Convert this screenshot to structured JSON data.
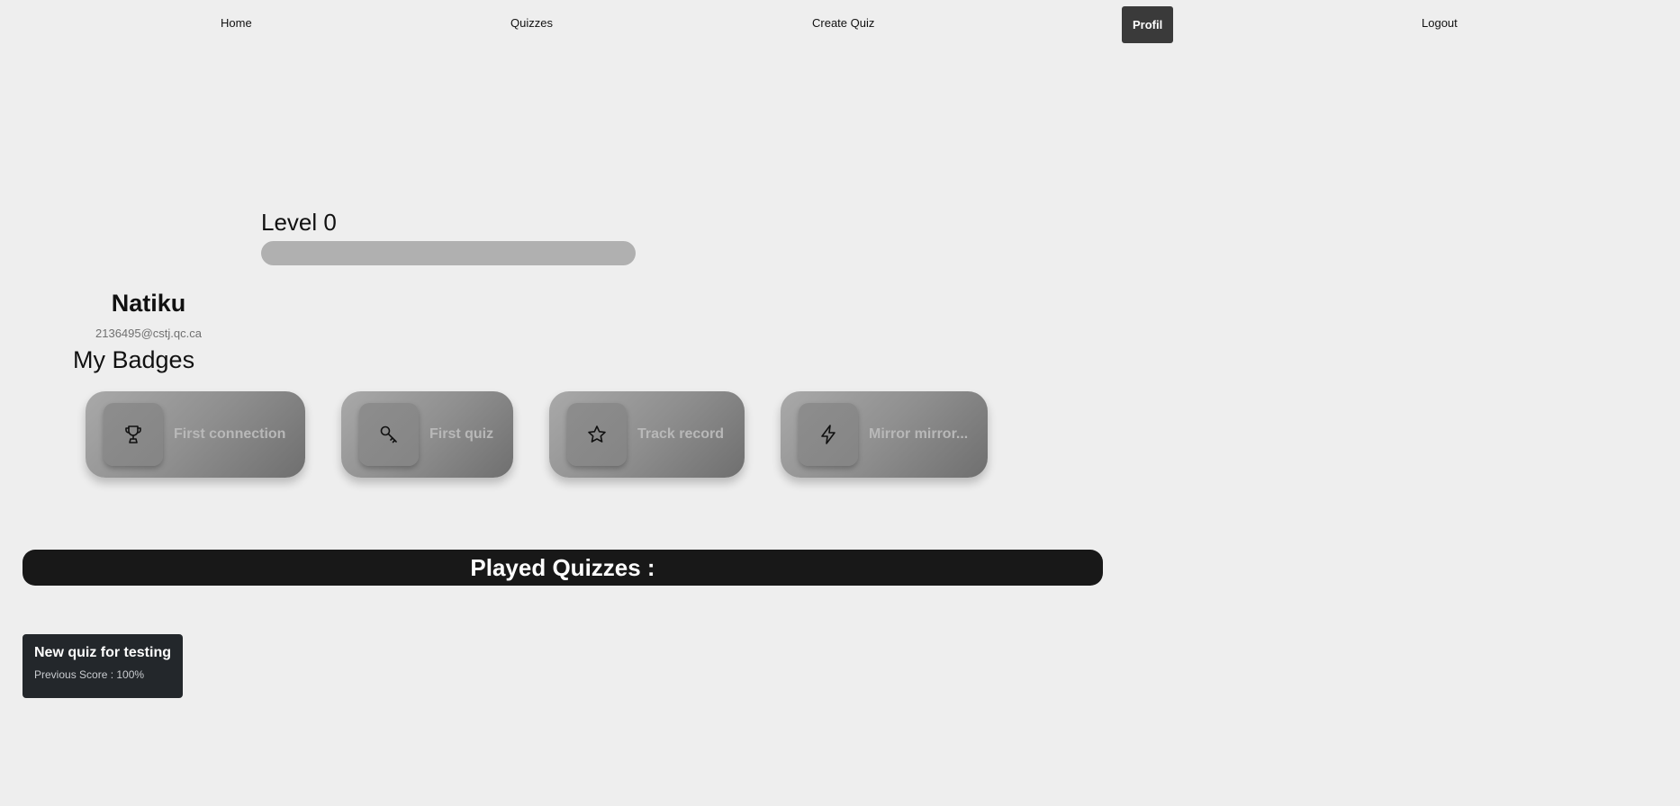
{
  "nav": {
    "home": "Home",
    "quizzes": "Quizzes",
    "create_quiz": "Create Quiz",
    "profil": "Profil",
    "logout": "Logout"
  },
  "level": {
    "label": "Level 0",
    "progress_fraction": 0
  },
  "user": {
    "name": "Natiku",
    "email": "2136495@cstj.qc.ca"
  },
  "badges": {
    "title": "My Badges",
    "items": [
      {
        "label": "First connection",
        "icon": "trophy-icon"
      },
      {
        "label": "First quiz",
        "icon": "key-icon"
      },
      {
        "label": "Track record",
        "icon": "star-icon"
      },
      {
        "label": "Mirror mirror...",
        "icon": "lightning-icon"
      }
    ]
  },
  "played": {
    "title": "Played Quizzes :",
    "quizzes": [
      {
        "title": "New quiz for testing",
        "score_label": "Previous Score : ",
        "score_value": "100%"
      }
    ]
  },
  "colors": {
    "background": "#eeeeee",
    "nav_active": "#3a3a3a",
    "played_bar": "#181818",
    "quiz_card": "#23272b"
  }
}
